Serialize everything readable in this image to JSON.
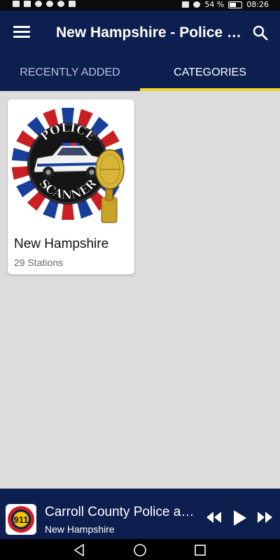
{
  "status_bar": {
    "battery_text": "54 %",
    "time": "08:26"
  },
  "app_bar": {
    "title": "New Hampshire - Police Scanner",
    "menu_icon": "menu-icon",
    "search_icon": "search-icon"
  },
  "tabs": [
    {
      "label": "RECENTLY ADDED",
      "active": false
    },
    {
      "label": "CATEGORIES",
      "active": true
    }
  ],
  "accent_color": "#f0d22a",
  "header_color": "#0d1f4e",
  "categories": [
    {
      "image_text_top": "POLICE",
      "image_text_bottom": "SCANNER",
      "name": "New Hampshire",
      "stations": "29 Stations"
    }
  ],
  "player": {
    "station": "Carroll County Police and Fire",
    "category": "New Hampshire",
    "art_label": "911",
    "controls": [
      "rewind-icon",
      "play-icon",
      "fast-forward-icon"
    ]
  },
  "nav": [
    "back-icon",
    "home-icon",
    "recents-icon"
  ]
}
